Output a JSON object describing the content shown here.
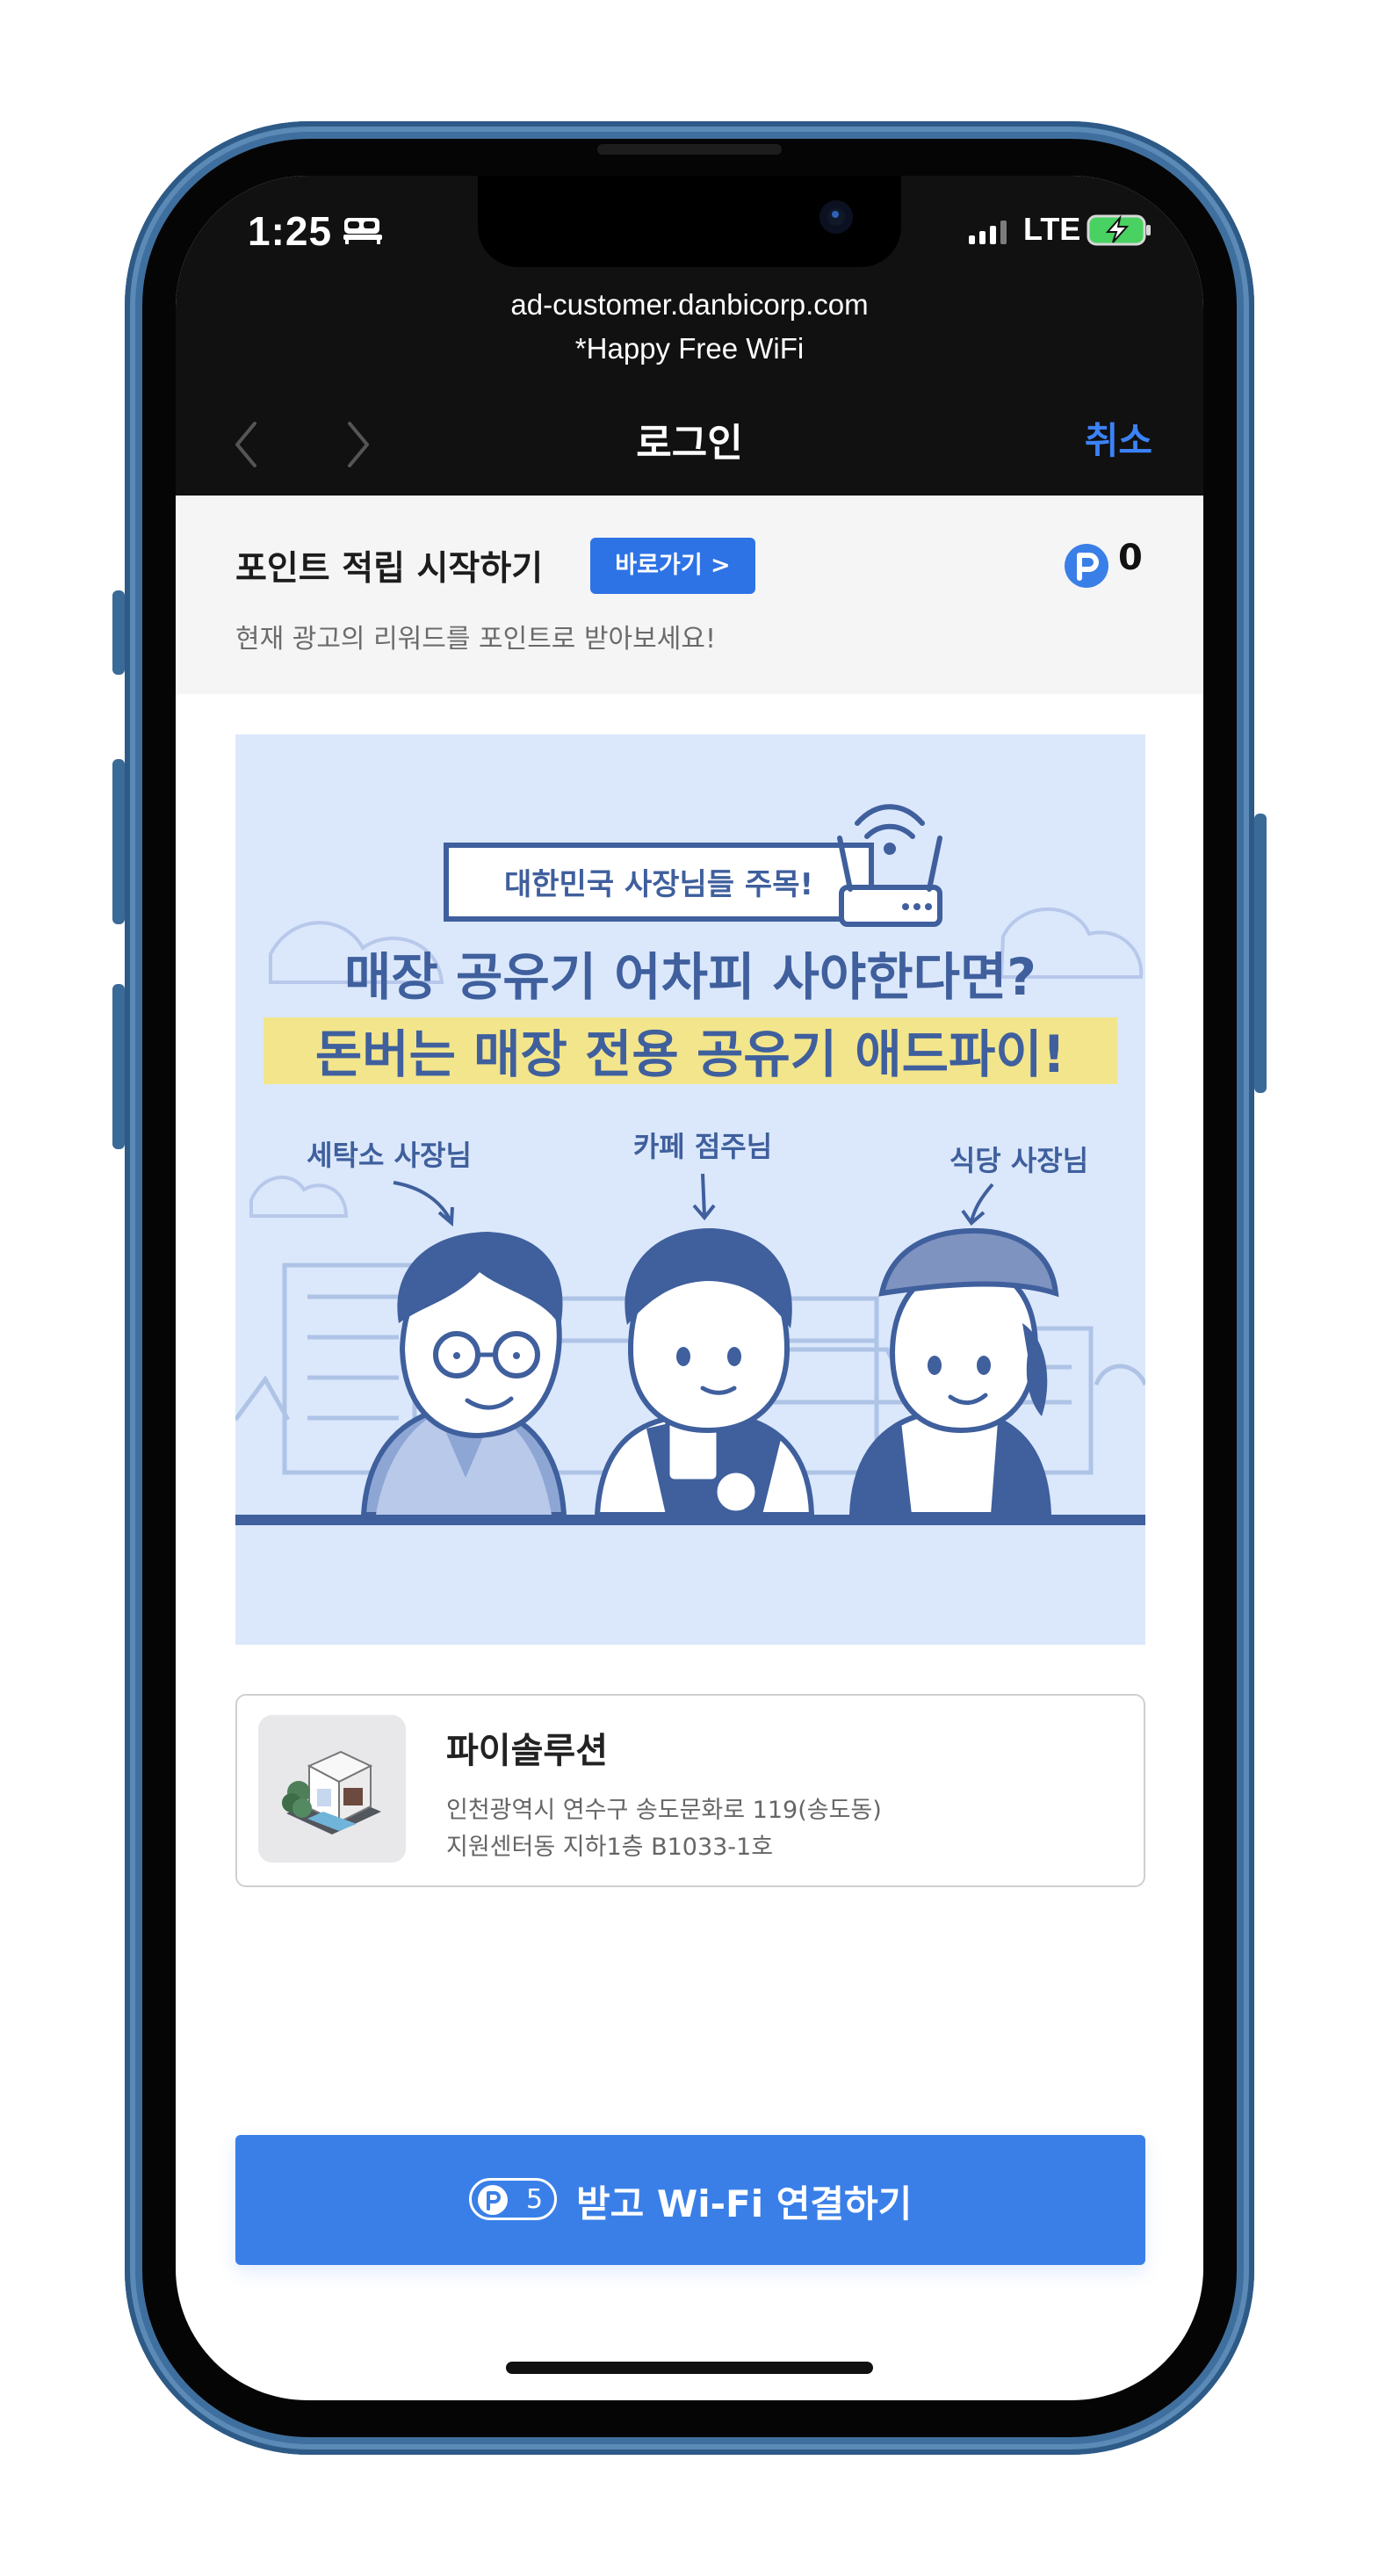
{
  "status_bar": {
    "time": "1:25",
    "sleep_icon": "bed-icon",
    "network": "LTE",
    "battery_icon": "battery-charging-icon"
  },
  "browser": {
    "url": "ad-customer.danbicorp.com",
    "network_name": "*Happy Free WiFi",
    "title": "로그인",
    "cancel_label": "취소",
    "back_icon": "chevron-left-icon",
    "forward_icon": "chevron-right-icon"
  },
  "points": {
    "title": "포인트 적립 시작하기",
    "shortcut_label": "바로가기 >",
    "subtitle": "현재 광고의 리워드를 포인트로 받아보세요!",
    "balance": "0",
    "icon": "point-p-icon"
  },
  "banner": {
    "badge": "대한민국 사장님들 주목!",
    "headline_1": "매장 공유기 어차피 사야한다면?",
    "headline_2": "돈버는 매장 전용 공유기 애드파이!",
    "person_1": "세탁소 사장님",
    "person_2": "카페 점주님",
    "person_3": "식당 사장님",
    "colors": {
      "background": "#dbe8fb",
      "ink": "#3f5f9d",
      "highlight": "#f3e58b"
    }
  },
  "store": {
    "name": "파이솔루션",
    "address_line_1": "인천광역시 연수구 송도문화로 119(송도동)",
    "address_line_2": "지원센터동 지하1층 B1033-1호",
    "image": "store-building-icon"
  },
  "connect_button": {
    "reward_count": "5",
    "label": "받고 Wi-Fi 연결하기"
  },
  "colors": {
    "accent": "#3a7fe8",
    "browser_bar": "#111111",
    "cancel": "#3b82f6"
  }
}
